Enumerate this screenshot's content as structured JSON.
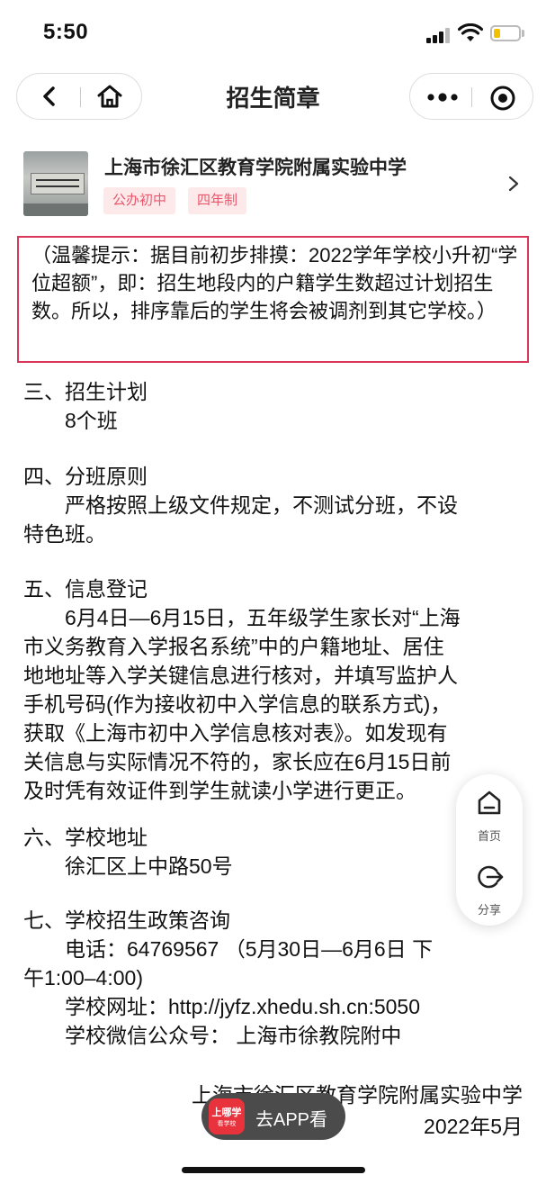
{
  "status_bar": {
    "time": "5:50"
  },
  "nav": {
    "title": "招生简章"
  },
  "school": {
    "name": "上海市徐汇区教育学院附属实验中学",
    "tags": [
      "公办初中",
      "四年制"
    ]
  },
  "notice": "（温馨提示：据目前初步排摸：2022学年学校小升初“学位超额”，即：招生地段内的户籍学生数超过计划招生数。所以，排序靠后的学生将会被调剂到其它学校。）",
  "sections": {
    "plan": {
      "heading": "三、招生计划",
      "lines": [
        "8个班"
      ]
    },
    "grouping": {
      "heading": "四、分班原则",
      "lines": [
        "严格按照上级文件规定，不测试分班，不设",
        "特色班。"
      ]
    },
    "registration": {
      "heading": "五、信息登记",
      "lines": [
        "6月4日—6月15日，五年级学生家长对“上海",
        "市义务教育入学报名系统”中的户籍地址、居住",
        "地地址等入学关键信息进行核对，并填写监护人",
        "手机号码(作为接收初中入学信息的联系方式)，",
        "获取《上海市初中入学信息核对表》。如发现有",
        "关信息与实际情况不符的，家长应在6月15日前",
        "及时凭有效证件到学生就读小学进行更正。"
      ]
    },
    "address": {
      "heading": "六、学校地址",
      "lines": [
        "徐汇区上中路50号"
      ]
    },
    "consult": {
      "heading": "七、学校招生政策咨询",
      "lines": [
        "电话：64769567 （5月30日—6月6日 下",
        "午1:00–4:00)",
        "学校网址：http://jyfz.xhedu.sh.cn:5050",
        "学校微信公众号： 上海市徐教院附中"
      ]
    }
  },
  "footer": {
    "org": "上海市徐汇区教育学院附属实验中学",
    "date": "2022年5月"
  },
  "float_panel": {
    "home_label": "首页",
    "share_label": "分享"
  },
  "go_app": {
    "logo_text": "上哪学",
    "logo_sub": "看学校",
    "label": "去APP看"
  },
  "colors": {
    "accent_red": "#d9365a",
    "tag_bg": "#fde9ea",
    "tag_text": "#e8576b"
  }
}
